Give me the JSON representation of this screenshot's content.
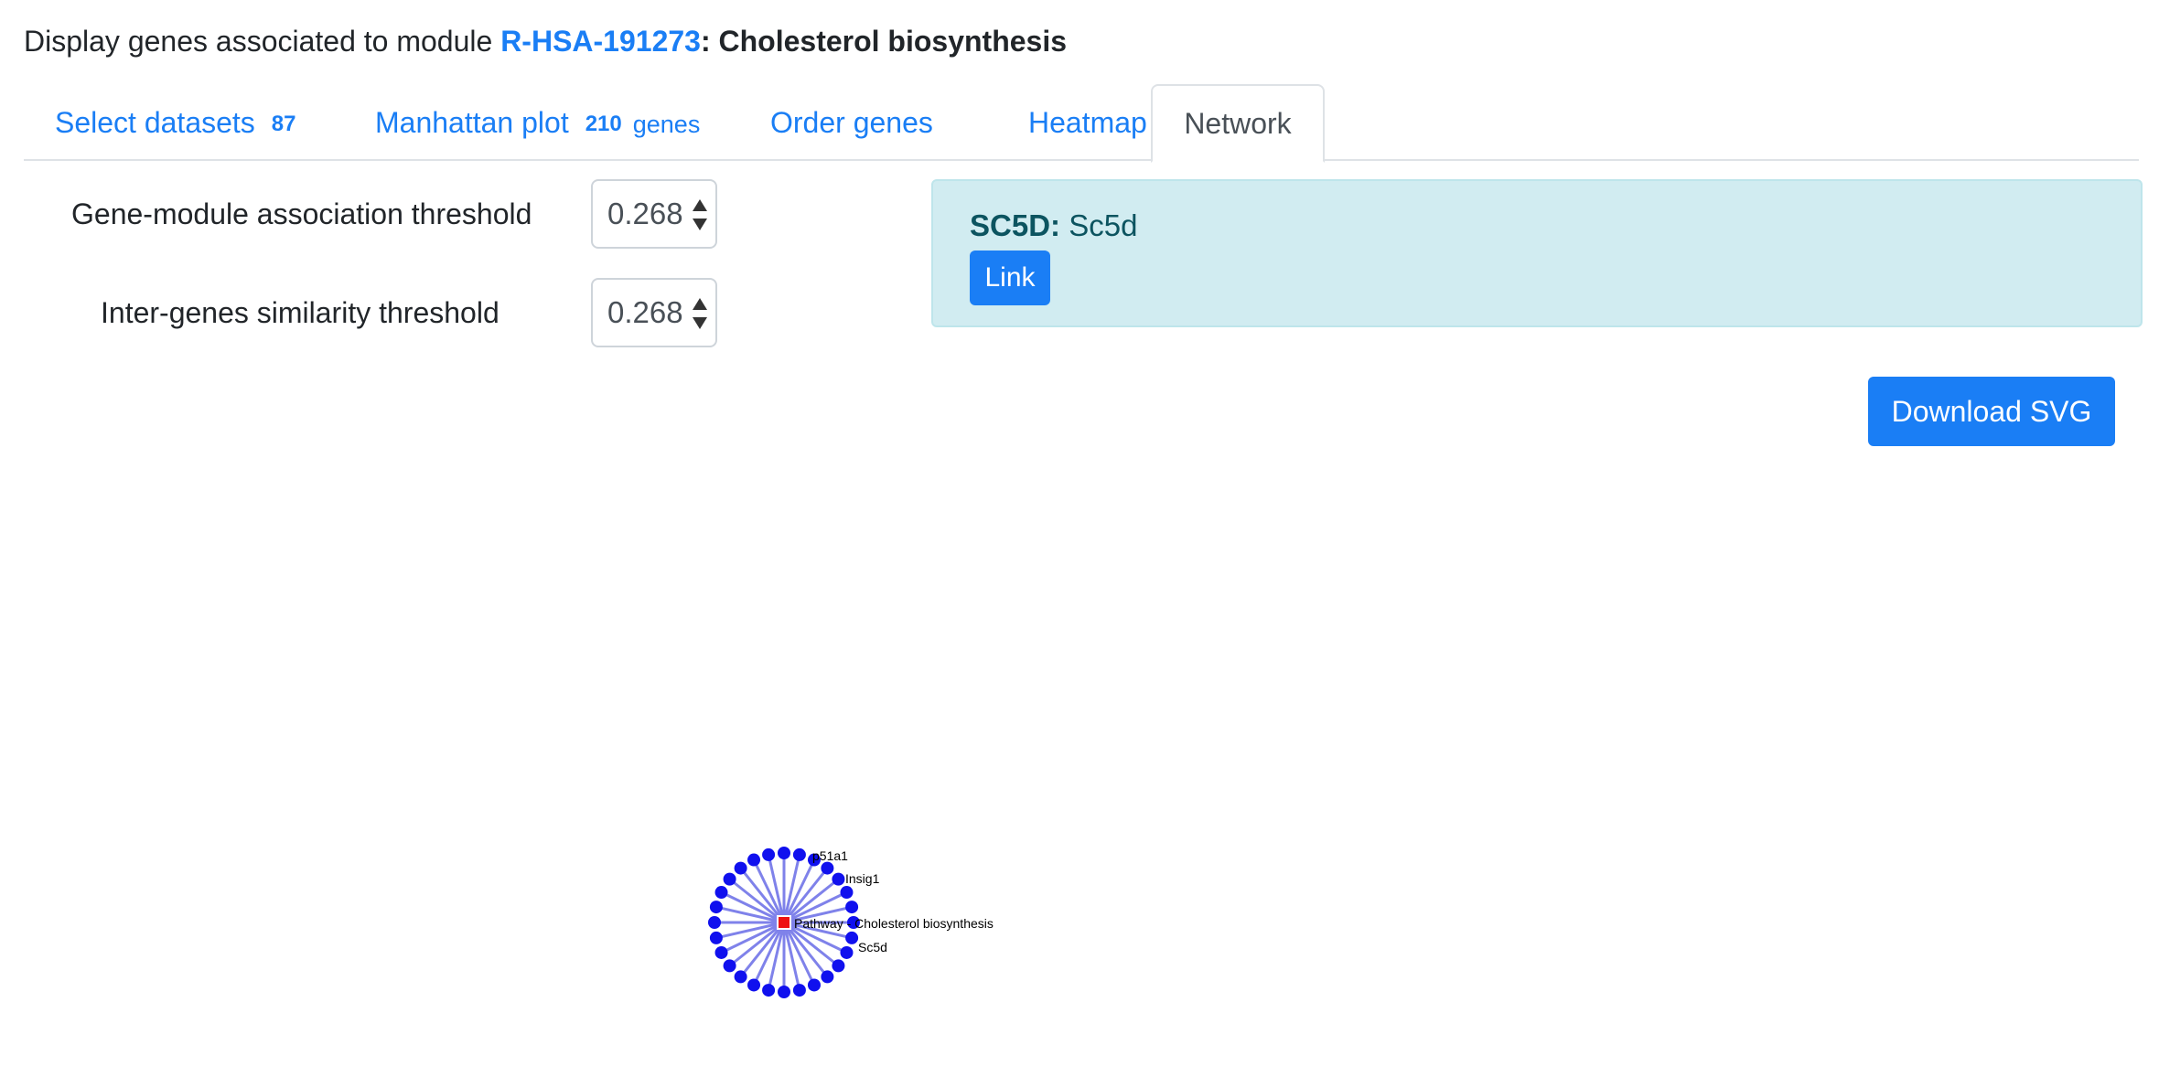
{
  "header": {
    "prefix": "Display genes associated to module",
    "module_id": "R-HSA-191273",
    "separator": ":",
    "module_name": "Cholesterol biosynthesis"
  },
  "tabs": [
    {
      "label": "Select datasets",
      "count": "87",
      "unit": ""
    },
    {
      "label": "Manhattan plot",
      "count": "210",
      "unit": "genes"
    },
    {
      "label": "Order genes",
      "count": "",
      "unit": ""
    },
    {
      "label": "Heatmap",
      "count": "",
      "unit": ""
    },
    {
      "label": "Network",
      "count": "",
      "unit": "",
      "active": true
    }
  ],
  "controls": {
    "gene_module_label": "Gene-module association threshold",
    "gene_module_value": "0.268",
    "inter_gene_label": "Inter-genes similarity threshold",
    "inter_gene_value": "0.268"
  },
  "info": {
    "symbol": "SC5D:",
    "name": "Sc5d",
    "link_label": "Link"
  },
  "download_label": "Download SVG",
  "network": {
    "center_label": "Pathway - Cholesterol biosynthesis",
    "node_labels": [
      "p51a1",
      "Insig1",
      "Sc5d"
    ],
    "node_count": 28,
    "colors": {
      "node": "#1010ee",
      "edge": "#7f82ea",
      "center": "#ee1111"
    }
  }
}
